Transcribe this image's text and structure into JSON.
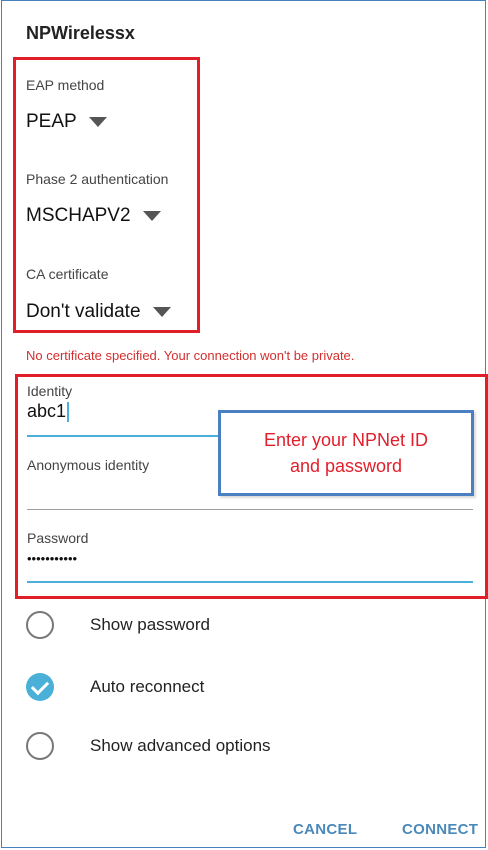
{
  "network_name": "NPWireless",
  "network_name_suffix": "x",
  "eap": {
    "label": "EAP method",
    "value": "PEAP"
  },
  "phase2": {
    "label": "Phase 2 authentication",
    "value": "MSCHAPV2"
  },
  "ca_cert": {
    "label": "CA certificate",
    "value": "Don't validate"
  },
  "warning": "No certificate specified. Your connection won't be private.",
  "identity": {
    "label": "Identity",
    "value": "abc1"
  },
  "anonymous": {
    "label": "Anonymous identity",
    "value": ""
  },
  "password": {
    "label": "Password",
    "value": "•••••••••••"
  },
  "callout": {
    "line1": "Enter your NPNet ID",
    "line2": "and password"
  },
  "options": [
    {
      "label": "Show password",
      "checked": false
    },
    {
      "label": "Auto reconnect",
      "checked": true
    },
    {
      "label": "Show advanced options",
      "checked": false
    }
  ],
  "buttons": {
    "cancel": "CANCEL",
    "connect": "CONNECT"
  },
  "colors": {
    "highlight_red": "#e11f2b",
    "accent_blue": "#4ab0d8",
    "button_blue": "#4a89b9",
    "warning_red": "#d32f2f",
    "frame_blue": "#4a7fc1"
  }
}
